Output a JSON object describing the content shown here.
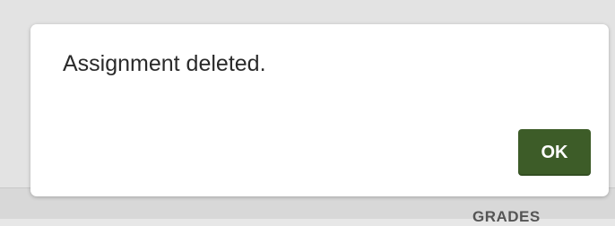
{
  "dialog": {
    "message": "Assignment deleted.",
    "ok_label": "OK"
  },
  "background": {
    "tab_label": "GRADES"
  },
  "colors": {
    "accent": "#3d5c28",
    "dialog_bg": "#ffffff",
    "backdrop": "#e3e3e3"
  }
}
